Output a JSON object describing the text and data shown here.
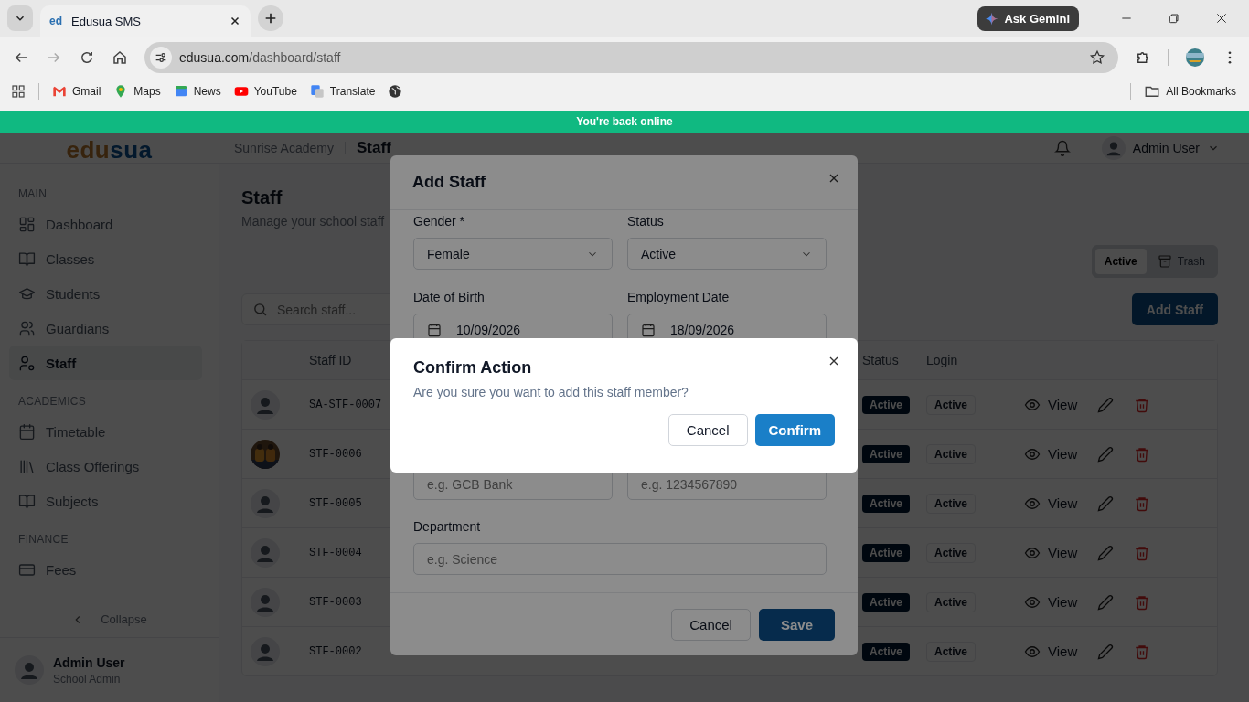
{
  "browser": {
    "tab_favicon": "ed",
    "tab_title": "Edusua SMS",
    "url_domain": "edusua.com",
    "url_path": "/dashboard/staff",
    "ask_button": "Ask Gemini",
    "bookmarks": [
      {
        "label": "Gmail"
      },
      {
        "label": "Maps"
      },
      {
        "label": "News"
      },
      {
        "label": "YouTube"
      },
      {
        "label": "Translate"
      }
    ],
    "all_bookmarks": "All Bookmarks"
  },
  "banner": "You're back online",
  "header": {
    "logo_part_1": "edu",
    "logo_part_2": "sua",
    "school": "Sunrise Academy",
    "page": "Staff",
    "user": "Admin User"
  },
  "sidebar": {
    "sections": [
      {
        "title": "MAIN",
        "items": [
          {
            "label": "Dashboard",
            "selected": false
          },
          {
            "label": "Classes",
            "selected": false
          },
          {
            "label": "Students",
            "selected": false
          },
          {
            "label": "Guardians",
            "selected": false
          },
          {
            "label": "Staff",
            "selected": true
          }
        ]
      },
      {
        "title": "ACADEMICS",
        "items": [
          {
            "label": "Timetable",
            "selected": false
          },
          {
            "label": "Class Offerings",
            "selected": false
          },
          {
            "label": "Subjects",
            "selected": false
          }
        ]
      },
      {
        "title": "FINANCE",
        "items": [
          {
            "label": "Fees",
            "selected": false
          }
        ]
      }
    ],
    "collapse": "Collapse",
    "user": {
      "name": "Admin User",
      "role": "School Admin"
    }
  },
  "page": {
    "title": "Staff",
    "subtitle": "Manage your school staff",
    "view_toggle": [
      {
        "label": "Active",
        "selected": true
      },
      {
        "label": "Trash",
        "selected": false
      }
    ],
    "search": {
      "placeholder": "Search staff..."
    },
    "add_button": "Add Staff"
  },
  "table": {
    "columns": [
      "Staff ID",
      "Status",
      "Login"
    ],
    "rows": [
      {
        "staff_id": "SA-STF-0007",
        "kind": "avatar",
        "status": "Active",
        "login": "Active",
        "action": "View"
      },
      {
        "staff_id": "STF-0006",
        "kind": "picture",
        "status": "Active",
        "login": "Active",
        "action": "View"
      },
      {
        "staff_id": "STF-0005",
        "kind": "avatar",
        "status": "Active",
        "login": "Active",
        "action": "View"
      },
      {
        "staff_id": "STF-0004",
        "kind": "avatar",
        "status": "Active",
        "login": "Active",
        "action": "View"
      },
      {
        "staff_id": "STF-0003",
        "kind": "avatar",
        "status": "Active",
        "login": "Active",
        "action": "View"
      },
      {
        "staff_id": "STF-0002",
        "kind": "avatar",
        "status": "Active",
        "login": "Active",
        "action": "View"
      }
    ]
  },
  "add_staff_modal": {
    "title": "Add Staff",
    "fields": [
      {
        "label": "Gender *",
        "kind": "select",
        "value": "Female"
      },
      {
        "label": "Status",
        "kind": "select",
        "value": "Active"
      },
      {
        "label": "Date of Birth",
        "kind": "date",
        "value": "10/09/2026"
      },
      {
        "label": "Employment Date",
        "kind": "date",
        "value": "18/09/2026"
      },
      {
        "kind": "text",
        "placeholder": "e.g. GCB Bank"
      },
      {
        "kind": "text",
        "placeholder": "e.g. 1234567890"
      },
      {
        "label": "Department",
        "kind": "text",
        "placeholder": "e.g. Science"
      }
    ],
    "cancel": "Cancel",
    "save": "Save"
  },
  "confirm_modal": {
    "title": "Confirm Action",
    "message": "Are you sure you want to add this staff member?",
    "cancel": "Cancel",
    "confirm": "Confirm"
  }
}
